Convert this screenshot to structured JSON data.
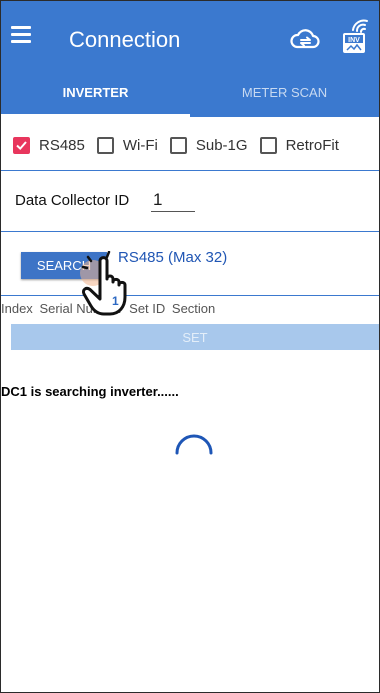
{
  "header": {
    "title": "Connection",
    "icons": [
      "menu-icon",
      "cloud-sync-icon",
      "inverter-wifi-icon"
    ],
    "inv_badge": "INV"
  },
  "tabs": [
    {
      "label": "INVERTER",
      "active": true
    },
    {
      "label": "METER SCAN",
      "active": false
    }
  ],
  "connection_types": [
    {
      "label": "RS485",
      "checked": true
    },
    {
      "label": "Wi-Fi",
      "checked": false
    },
    {
      "label": "Sub-1G",
      "checked": false
    },
    {
      "label": "RetroFit",
      "checked": false
    }
  ],
  "data_collector": {
    "label": "Data Collector ID",
    "value": "1"
  },
  "search": {
    "button_label": "SEARCH",
    "mode_label": "RS485 (Max 32)"
  },
  "table": {
    "columns": [
      "Index",
      "Serial Number",
      "Set ID",
      "Section"
    ],
    "overlay_count": "1"
  },
  "set_button": {
    "label": "SET"
  },
  "status_text": "DC1 is searching inverter......",
  "colors": {
    "primary": "#3b79cf",
    "checkbox_checked": "#e8365d",
    "set_button_disabled": "#a8c8ec"
  }
}
